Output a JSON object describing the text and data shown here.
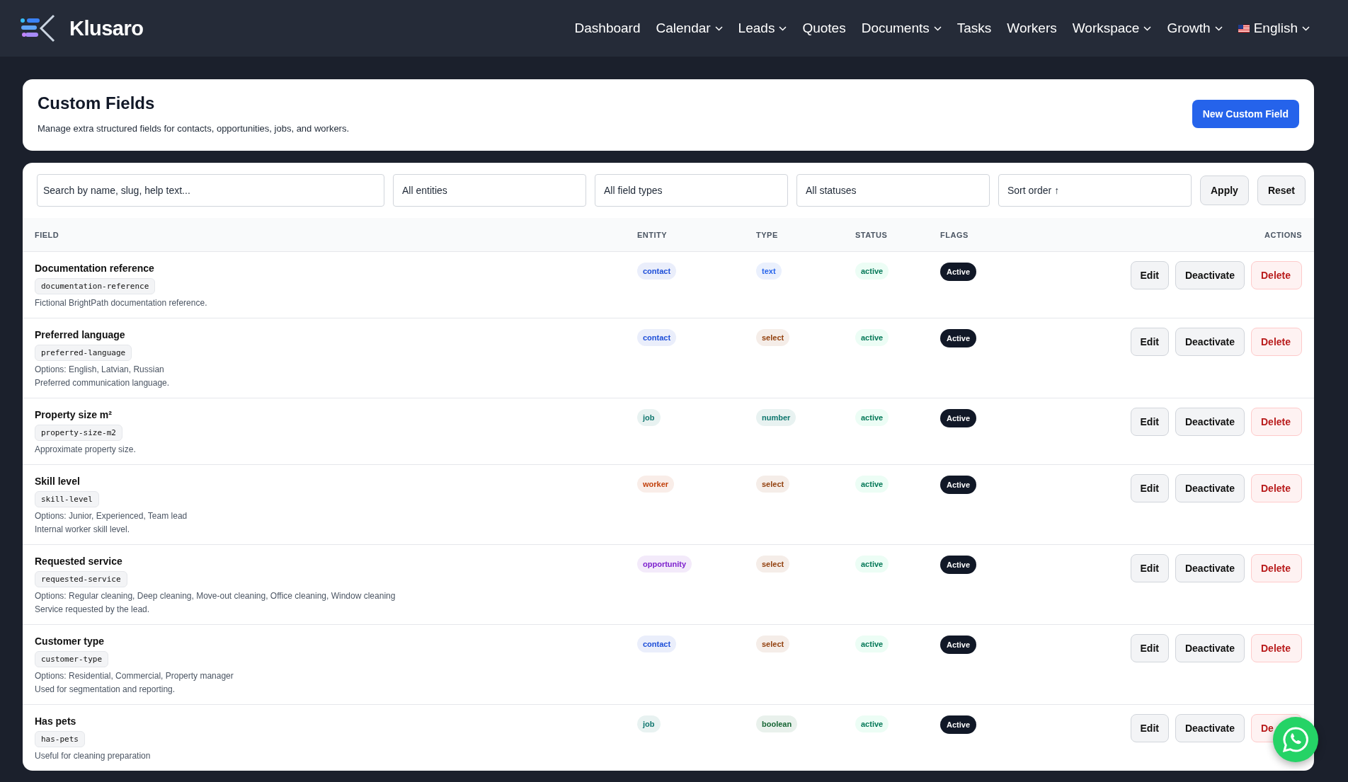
{
  "nav": {
    "brand": "Klusaro",
    "items": [
      {
        "label": "Dashboard",
        "dropdown": false
      },
      {
        "label": "Calendar",
        "dropdown": true
      },
      {
        "label": "Leads",
        "dropdown": true
      },
      {
        "label": "Quotes",
        "dropdown": false
      },
      {
        "label": "Documents",
        "dropdown": true
      },
      {
        "label": "Tasks",
        "dropdown": false
      },
      {
        "label": "Workers",
        "dropdown": false
      },
      {
        "label": "Workspace",
        "dropdown": true
      },
      {
        "label": "Growth",
        "dropdown": true
      }
    ],
    "language": {
      "label": "English",
      "dropdown": true
    }
  },
  "header": {
    "title": "Custom Fields",
    "subtitle": "Manage extra structured fields for contacts, opportunities, jobs, and workers.",
    "primary_button": "New Custom Field"
  },
  "filters": {
    "search": {
      "placeholder": "Search by name, slug, help text..."
    },
    "selects": [
      {
        "value": "All entities"
      },
      {
        "value": "All field types"
      },
      {
        "value": "All statuses"
      },
      {
        "value": "Sort order ↑"
      }
    ],
    "buttons": [
      "Apply",
      "Reset"
    ]
  },
  "table": {
    "columns": [
      "FIELD",
      "ENTITY",
      "TYPE",
      "STATUS",
      "FLAGS",
      "ACTIONS"
    ],
    "rows": [
      {
        "name": "Documentation reference",
        "slug": "documentation-reference",
        "notes": [
          "Fictional BrightPath documentation reference."
        ],
        "entity": {
          "label": "contact",
          "color": "#1d4ed8"
        },
        "type": {
          "label": "text",
          "color": "#2563eb"
        },
        "status": "active",
        "flag": "Active",
        "actions": [
          "Edit",
          "Deactivate",
          "Delete"
        ]
      },
      {
        "name": "Preferred language",
        "slug": "preferred-language",
        "notes": [
          "Options: English, Latvian, Russian",
          "Preferred communication language."
        ],
        "entity": {
          "label": "contact",
          "color": "#1d4ed8"
        },
        "type": {
          "label": "select",
          "color": "#92400e"
        },
        "status": "active",
        "flag": "Active",
        "actions": [
          "Edit",
          "Deactivate",
          "Delete"
        ]
      },
      {
        "name": "Property size m²",
        "slug": "property-size-m2",
        "notes": [
          "Approximate property size."
        ],
        "entity": {
          "label": "job",
          "color": "#0f766e"
        },
        "type": {
          "label": "number",
          "color": "#0f766e"
        },
        "status": "active",
        "flag": "Active",
        "actions": [
          "Edit",
          "Deactivate",
          "Delete"
        ]
      },
      {
        "name": "Skill level",
        "slug": "skill-level",
        "notes": [
          "Options: Junior, Experienced, Team lead",
          "Internal worker skill level."
        ],
        "entity": {
          "label": "worker",
          "color": "#c2410c"
        },
        "type": {
          "label": "select",
          "color": "#92400e"
        },
        "status": "active",
        "flag": "Active",
        "actions": [
          "Edit",
          "Deactivate",
          "Delete"
        ]
      },
      {
        "name": "Requested service",
        "slug": "requested-service",
        "notes": [
          "Options: Regular cleaning, Deep cleaning, Move-out cleaning, Office cleaning, Window cleaning",
          "Service requested by the lead."
        ],
        "entity": {
          "label": "opportunity",
          "color": "#7e22ce"
        },
        "type": {
          "label": "select",
          "color": "#92400e"
        },
        "status": "active",
        "flag": "Active",
        "actions": [
          "Edit",
          "Deactivate",
          "Delete"
        ]
      },
      {
        "name": "Customer type",
        "slug": "customer-type",
        "notes": [
          "Options: Residential, Commercial, Property manager",
          "Used for segmentation and reporting."
        ],
        "entity": {
          "label": "contact",
          "color": "#1d4ed8"
        },
        "type": {
          "label": "select",
          "color": "#92400e"
        },
        "status": "active",
        "flag": "Active",
        "actions": [
          "Edit",
          "Deactivate",
          "Delete"
        ]
      },
      {
        "name": "Has pets",
        "slug": "has-pets",
        "notes": [
          "Useful for cleaning preparation"
        ],
        "entity": {
          "label": "job",
          "color": "#0f766e"
        },
        "type": {
          "label": "boolean",
          "color": "#166534"
        },
        "status": "active",
        "flag": "Active",
        "actions": [
          "Edit",
          "Deactivate",
          "De"
        ]
      }
    ]
  }
}
